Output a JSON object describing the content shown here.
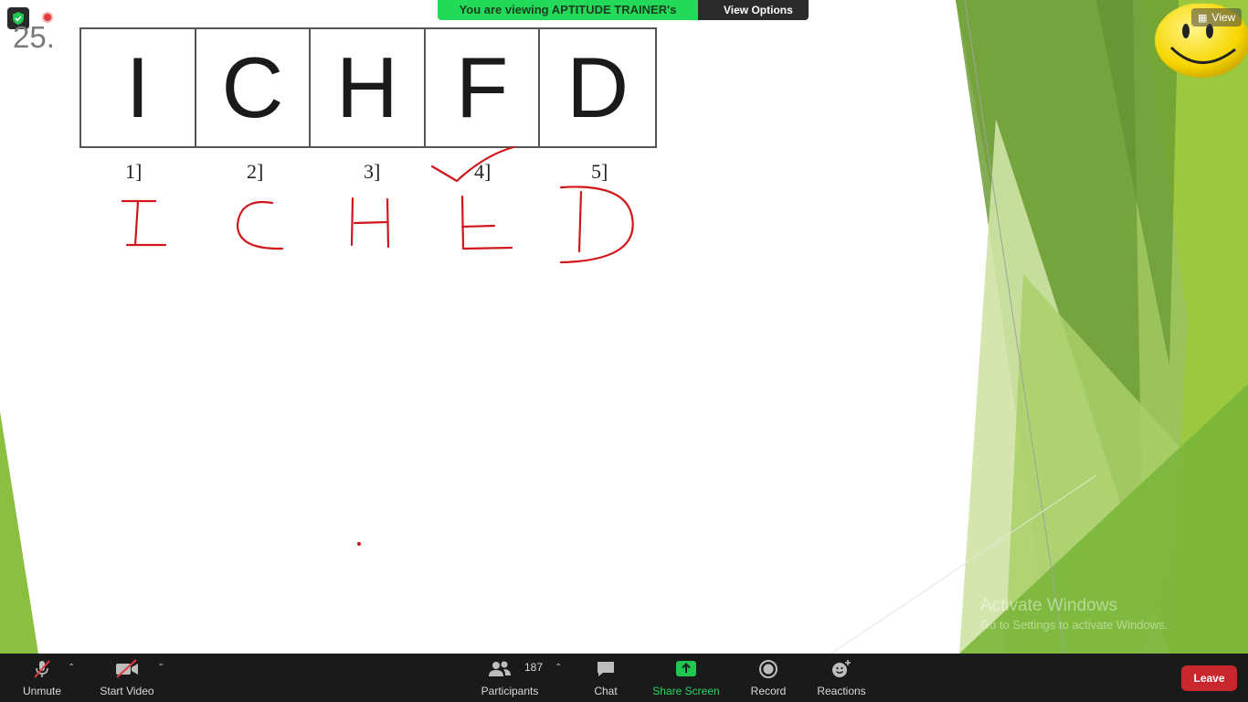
{
  "slide": {
    "number": "25.",
    "letters": [
      "I",
      "C",
      "H",
      "F",
      "D"
    ],
    "labels": [
      "1]",
      "2]",
      "3]",
      "4]",
      "5]"
    ]
  },
  "annotations": {
    "ink_color": "#d0161b",
    "handwritten_letters": [
      "I",
      "C",
      "H",
      "E",
      "D"
    ]
  },
  "share_banner": {
    "text": "You are viewing APTITUDE TRAINER's screen",
    "view_options": "View Options"
  },
  "view_button": "View",
  "watermark": {
    "title": "Activate Windows",
    "subtitle": "Go to Settings to activate Windows."
  },
  "toolbar": {
    "unmute": "Unmute",
    "start_video": "Start Video",
    "participants": "Participants",
    "participant_count": "187",
    "chat": "Chat",
    "share_screen": "Share Screen",
    "record": "Record",
    "reactions": "Reactions",
    "leave": "Leave"
  },
  "colors": {
    "banner_green": "#23d959",
    "leave_red": "#c8282d",
    "share_green": "#2fd25e",
    "toolbar_bg": "#1a1a1a"
  }
}
